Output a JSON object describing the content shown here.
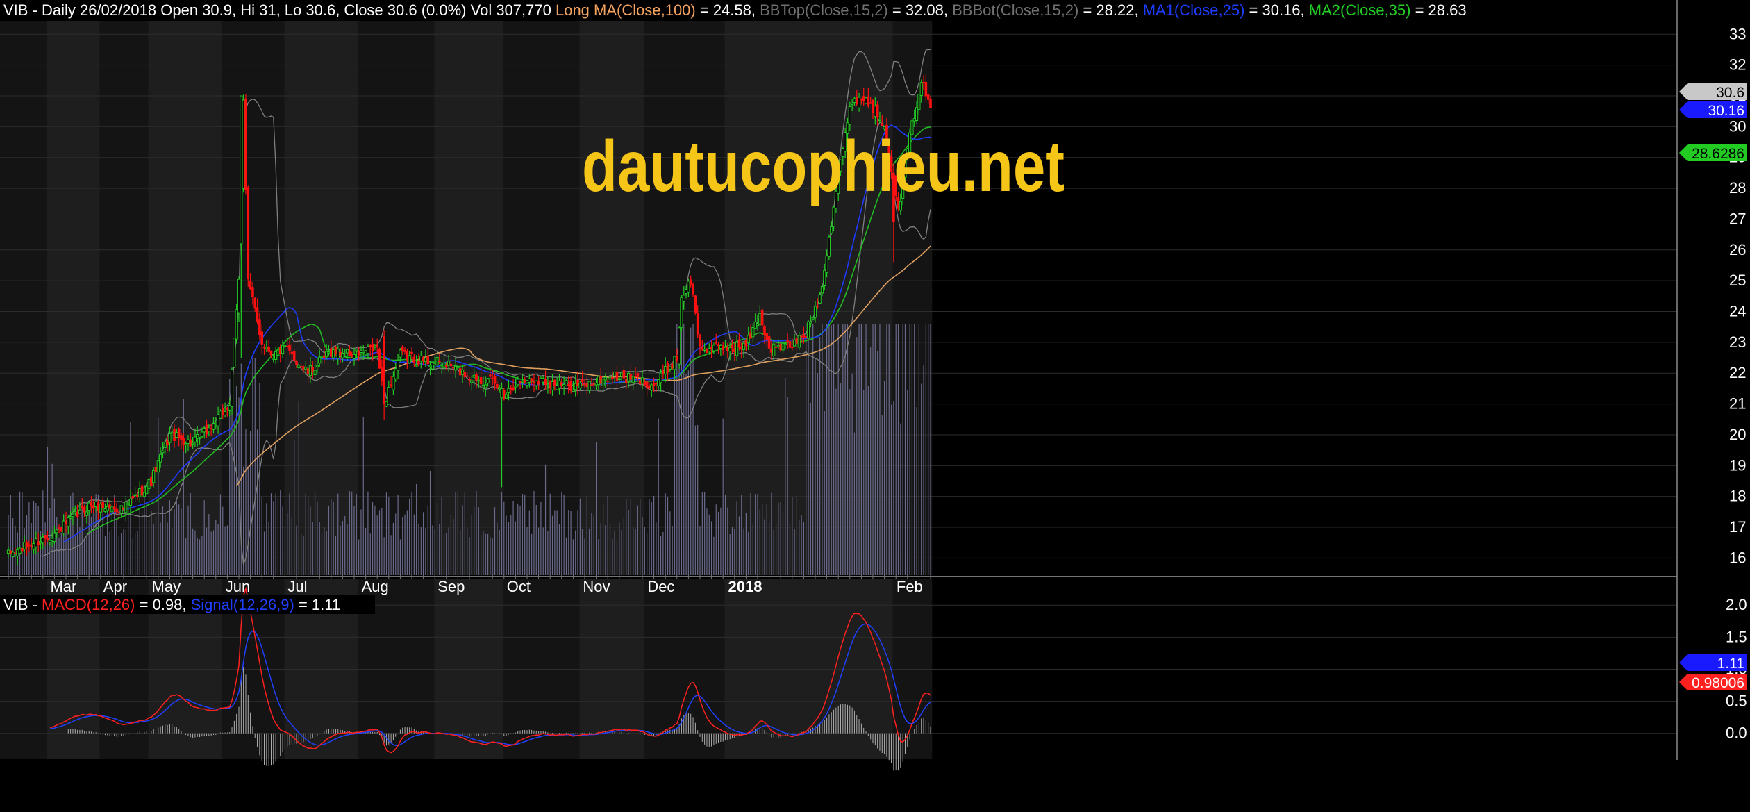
{
  "header": {
    "parts": [
      {
        "text": "VIB - Daily 26/02/2018 Open 30.9, Hi 31, Lo 30.6, Close 30.6 (0.0%) Vol 307,770 ",
        "color": "#ffffff"
      },
      {
        "text": "Long MA(Close,100)",
        "color": "#f4a460"
      },
      {
        "text": " = 24.58, ",
        "color": "#ffffff"
      },
      {
        "text": "BBTop(Close,15,2)",
        "color": "#707070"
      },
      {
        "text": " = 32.08, ",
        "color": "#ffffff"
      },
      {
        "text": "BBBot(Close,15,2)",
        "color": "#707070"
      },
      {
        "text": " = 28.22, ",
        "color": "#ffffff"
      },
      {
        "text": "MA1(Close,25)",
        "color": "#1e3cff"
      },
      {
        "text": " = 30.16, ",
        "color": "#ffffff"
      },
      {
        "text": "MA2(Close,35)",
        "color": "#22cc22"
      },
      {
        "text": " = 28.63",
        "color": "#ffffff"
      }
    ]
  },
  "watermark": "dautucophieu.net",
  "macd_header": {
    "parts": [
      {
        "text": "VIB - ",
        "color": "#ffffff"
      },
      {
        "text": "MACD(12,26)",
        "color": "#ff2020"
      },
      {
        "text": " = 0.98, ",
        "color": "#ffffff"
      },
      {
        "text": "Signal(12,26,9)",
        "color": "#2040ff"
      },
      {
        "text": " = 1.11",
        "color": "#ffffff"
      }
    ]
  },
  "price_tags": [
    {
      "label": "30.6",
      "value": 30.6,
      "bg": "#c8c8c8",
      "fg": "#000000"
    },
    {
      "label": "30.16",
      "value": 30.0,
      "bg": "#1a1aff",
      "fg": "#ffffff"
    },
    {
      "label": "28.6286",
      "value": 28.63,
      "bg": "#22cc22",
      "fg": "#000000"
    }
  ],
  "macd_tags": [
    {
      "label": "1.11",
      "value": 1.11,
      "bg": "#1a1aff",
      "fg": "#ffffff"
    },
    {
      "label": "0.98006",
      "value": 0.98,
      "bg": "#ff2020",
      "fg": "#ffffff"
    }
  ],
  "colors": {
    "background": "#000000",
    "band_light": "#1e1e1e",
    "band_dark": "#141414",
    "grid": "#2c2c2c",
    "up_candle": "#22cc22",
    "down_candle": "#ff1010",
    "volume": "#6a6a8c",
    "bollinger": "#808080",
    "ma_long": "#e0a060",
    "ma1": "#1e3cff",
    "ma2": "#22bb22",
    "macd": "#ff2020",
    "signal": "#2040ff",
    "histogram": "#b0b0b0",
    "axis_text": "#ffffff",
    "watermark": "#f5c518"
  },
  "chart_data": [
    {
      "type": "candlestick",
      "title": "VIB - Daily",
      "x_labels": [
        "Mar",
        "Apr",
        "May",
        "Jun",
        "Jul",
        "Aug",
        "Sep",
        "Oct",
        "Nov",
        "Dec",
        "2018",
        "Feb"
      ],
      "y_ticks": [
        16,
        17,
        18,
        19,
        20,
        21,
        22,
        23,
        24,
        25,
        26,
        27,
        28,
        29,
        30,
        31,
        32,
        33
      ],
      "ylim": [
        15.4,
        33.3
      ],
      "grid": true,
      "close_anchors": [
        [
          0,
          16.1
        ],
        [
          20,
          16.8
        ],
        [
          35,
          17.7
        ],
        [
          50,
          17.6
        ],
        [
          62,
          18.5
        ],
        [
          70,
          20
        ],
        [
          80,
          19.7
        ],
        [
          90,
          20.4
        ],
        [
          96,
          21
        ],
        [
          100,
          25
        ],
        [
          101,
          28
        ],
        [
          102,
          31
        ],
        [
          104,
          25
        ],
        [
          110,
          23
        ],
        [
          115,
          22.6
        ],
        [
          120,
          22.8
        ],
        [
          130,
          22
        ],
        [
          140,
          22.7
        ],
        [
          150,
          22.6
        ],
        [
          160,
          22.8
        ],
        [
          163,
          21
        ],
        [
          170,
          22.6
        ],
        [
          180,
          22.4
        ],
        [
          190,
          22.3
        ],
        [
          200,
          21.9
        ],
        [
          210,
          21.7
        ],
        [
          215,
          21.3
        ],
        [
          220,
          21.7
        ],
        [
          230,
          21.8
        ],
        [
          240,
          21.6
        ],
        [
          250,
          21.6
        ],
        [
          262,
          21.9
        ],
        [
          272,
          21.8
        ],
        [
          280,
          21.6
        ],
        [
          290,
          22.5
        ],
        [
          292,
          24.5
        ],
        [
          296,
          25
        ],
        [
          300,
          22.8
        ],
        [
          310,
          22.8
        ],
        [
          320,
          22.9
        ],
        [
          326,
          23.9
        ],
        [
          330,
          22.8
        ],
        [
          340,
          22.9
        ],
        [
          346,
          23.3
        ],
        [
          352,
          24.5
        ],
        [
          356,
          26.4
        ],
        [
          360,
          28.5
        ],
        [
          366,
          30.9
        ],
        [
          372,
          30.9
        ],
        [
          380,
          30.1
        ],
        [
          386,
          27.2
        ],
        [
          390,
          29.3
        ],
        [
          396,
          31.5
        ],
        [
          400,
          30.6
        ]
      ],
      "special_candles": [
        {
          "index": 101,
          "open": 26.2,
          "close": 31.0,
          "high": 31.0,
          "low": 22.5
        },
        {
          "index": 214,
          "open": 21.2,
          "close": 21.5,
          "high": 21.7,
          "low": 18.3
        },
        {
          "index": 163,
          "open": 23.2,
          "close": 21.0,
          "high": 23.4,
          "low": 20.5
        },
        {
          "index": 384,
          "open": 28.5,
          "close": 26.9,
          "high": 28.8,
          "low": 25.6
        }
      ],
      "series": [
        {
          "name": "Long MA(Close,100)",
          "last": 24.58
        },
        {
          "name": "BBTop(Close,15,2)",
          "last": 32.08
        },
        {
          "name": "BBBot(Close,15,2)",
          "last": 28.22
        },
        {
          "name": "MA1(Close,25)",
          "last": 30.16
        },
        {
          "name": "MA2(Close,35)",
          "last": 28.63
        }
      ],
      "last_bar": {
        "date": "26/02/2018",
        "open": 30.9,
        "high": 31,
        "low": 30.6,
        "close": 30.6,
        "change": "0.0%",
        "volume": 307770
      }
    },
    {
      "type": "line",
      "title": "MACD",
      "y_ticks": [
        0.0,
        0.5,
        1.0,
        1.5,
        2.0
      ],
      "y_tick_labels": [
        "0.0",
        "0.5",
        "1.0",
        "1.5",
        "2.0"
      ],
      "ylim": [
        -0.35,
        2.1
      ],
      "series": [
        {
          "name": "MACD(12,26)",
          "last": 0.98
        },
        {
          "name": "Signal(12,26,9)",
          "last": 1.11
        }
      ]
    }
  ]
}
